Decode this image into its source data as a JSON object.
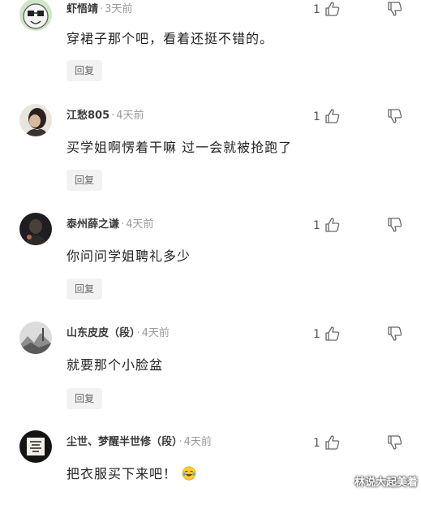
{
  "comments": [
    {
      "username": "虾悟靖",
      "time": "3天前",
      "text": "穿裙子那个吧，看着还挺不错的。",
      "likes": "1",
      "reply_label": "回复",
      "avatar_icon": "smiling-face-avatar"
    },
    {
      "username": "江愁805",
      "time": "4天前",
      "text": "买学姐啊愣着干嘛 过一会就被抢跑了",
      "likes": "1",
      "reply_label": "回复",
      "avatar_icon": "portrait-photo-avatar"
    },
    {
      "username": "泰州薛之谦",
      "time": "4天前",
      "text": "你问问学姐聘礼多少",
      "likes": "1",
      "reply_label": "回复",
      "avatar_icon": "dark-photo-avatar"
    },
    {
      "username": "山东皮皮（段）",
      "time": "4天前",
      "text": "就要那个小脸盆",
      "likes": "1",
      "reply_label": "回复",
      "avatar_icon": "landscape-photo-avatar"
    },
    {
      "username": "尘世、梦醒半世修（段）",
      "time": "4天前",
      "text": "把衣服买下来吧！",
      "likes": "1",
      "reply_label": "回复",
      "avatar_icon": "calligraphy-avatar",
      "emoji": "laughing-tears-emoji"
    }
  ],
  "separator": "·",
  "watermark": "林说大起美着"
}
